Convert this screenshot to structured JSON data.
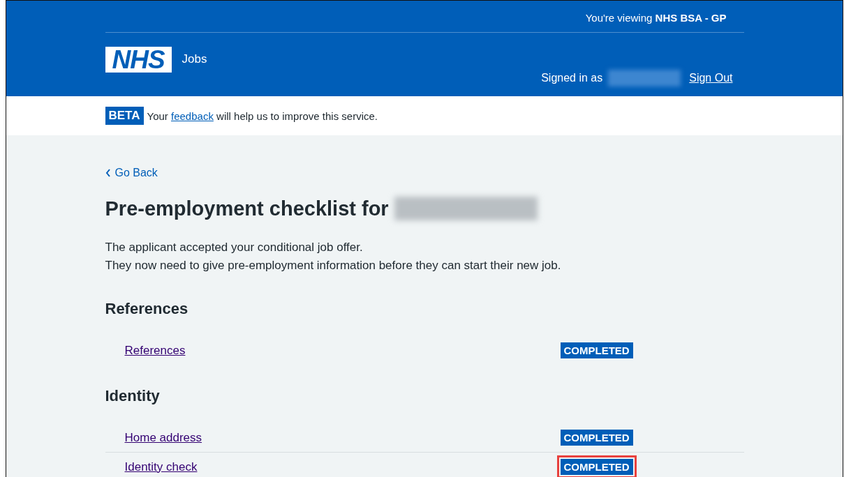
{
  "header": {
    "viewing_prefix": "You're viewing ",
    "viewing_org": "NHS BSA - GP",
    "logo": "NHS",
    "service": "Jobs",
    "signed_in_label": "Signed in as",
    "sign_out": "Sign Out"
  },
  "beta_banner": {
    "tag": "BETA",
    "before": "Your ",
    "link": "feedback",
    "after": " will help us to improve this service."
  },
  "back_link": "Go Back",
  "title": "Pre-employment checklist for",
  "intro": [
    "The applicant accepted your conditional job offer.",
    "They now need to give pre-employment information before they can start their new job."
  ],
  "sections": [
    {
      "heading": "References",
      "items": [
        {
          "label": "References",
          "status": "COMPLETED",
          "highlighted": false
        }
      ]
    },
    {
      "heading": "Identity",
      "items": [
        {
          "label": "Home address",
          "status": "COMPLETED",
          "highlighted": false
        },
        {
          "label": "Identity check",
          "status": "COMPLETED",
          "highlighted": true
        }
      ]
    }
  ]
}
